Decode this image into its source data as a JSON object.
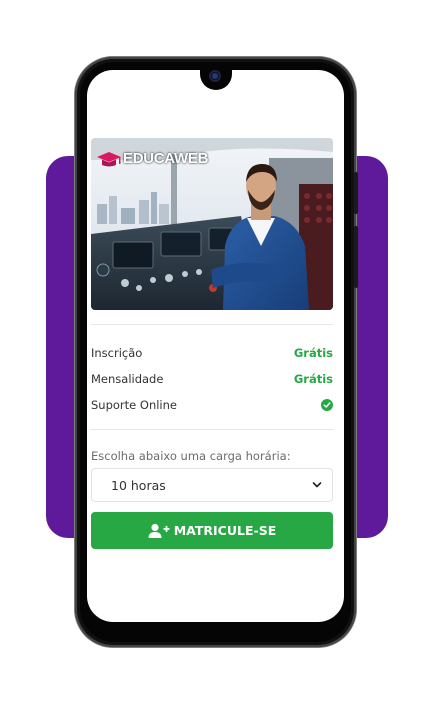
{
  "brand": {
    "name": "EDUCAWEB"
  },
  "pricing": {
    "enrollment_label": "Inscrição",
    "enrollment_value": "Grátis",
    "monthly_label": "Mensalidade",
    "monthly_value": "Grátis",
    "support_label": "Suporte Online"
  },
  "workload": {
    "hint": "Escolha abaixo uma carga horária:",
    "selected": "10 horas"
  },
  "cta": {
    "label": "MATRICULE-SE"
  },
  "colors": {
    "accent_green": "#28a745",
    "brand_purple": "#5e1a9a"
  },
  "icons": {
    "logo": "graduation-cap-icon",
    "support": "check-circle-icon",
    "select": "chevron-down-icon",
    "cta": "user-plus-icon"
  }
}
